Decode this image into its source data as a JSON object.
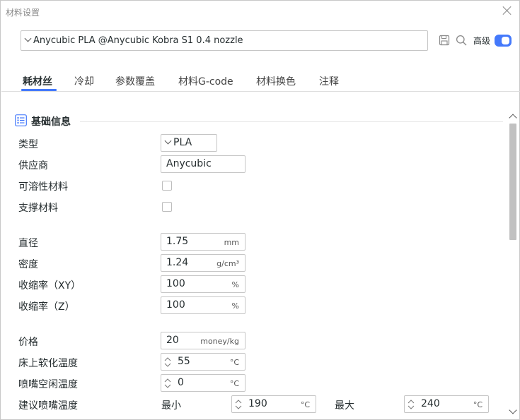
{
  "window": {
    "title": "材料设置"
  },
  "header": {
    "preset": "Anycubic PLA @Anycubic Kobra S1 0.4 nozzle",
    "advanced_label": "高级",
    "advanced_enabled": true
  },
  "tabs": [
    {
      "label": "耗材丝",
      "active": true
    },
    {
      "label": "冷却"
    },
    {
      "label": "参数覆盖"
    },
    {
      "label": "材料G-code"
    },
    {
      "label": "材料换色"
    },
    {
      "label": "注释"
    }
  ],
  "section": {
    "title": "基础信息"
  },
  "fields": {
    "type": {
      "label": "类型",
      "value": "PLA"
    },
    "vendor": {
      "label": "供应商",
      "value": "Anycubic"
    },
    "soluble": {
      "label": "可溶性材料",
      "checked": false
    },
    "support": {
      "label": "支撑材料",
      "checked": false
    },
    "diameter": {
      "label": "直径",
      "value": "1.75",
      "unit": "mm"
    },
    "density": {
      "label": "密度",
      "value": "1.24",
      "unit": "g/cm³"
    },
    "shrink_xy": {
      "label": "收缩率（XY）",
      "value": "100",
      "unit": "%"
    },
    "shrink_z": {
      "label": "收缩率（Z）",
      "value": "100",
      "unit": "%"
    },
    "price": {
      "label": "价格",
      "value": "20",
      "unit": "money/kg"
    },
    "bed_soften": {
      "label": "床上软化温度",
      "value": "55",
      "unit": "°C"
    },
    "nozzle_idle": {
      "label": "喷嘴空闲温度",
      "value": "0",
      "unit": "°C"
    },
    "nozzle_range": {
      "label": "建议喷嘴温度",
      "min_label": "最小",
      "min_value": "190",
      "min_unit": "°C",
      "max_label": "最大",
      "max_value": "240",
      "max_unit": "°C"
    }
  },
  "icons": {
    "save": "save-icon",
    "search": "search-icon",
    "section": "list-icon",
    "close": "close-icon"
  },
  "colors": {
    "accent": "#4479fb"
  }
}
